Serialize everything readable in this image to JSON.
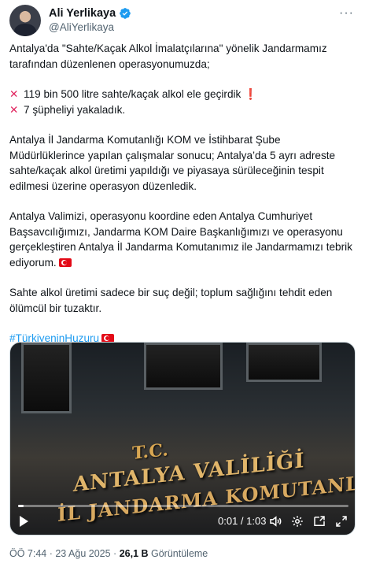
{
  "tweet": {
    "author_name": "Ali Yerlikaya",
    "author_handle": "@AliYerlikaya",
    "more_icon": "more-horizontal-icon",
    "paragraphs": {
      "intro_1": "Antalya'da \"Sahte/Kaçak Alkol İmalatçılarına\" yönelik Jandarmamız",
      "intro_2": "tarafından düzenlenen operasyonumuzda;",
      "bullet_1": "119 bin 500 litre sahte/kaçak alkol ele geçirdik",
      "bullet_1_mark": "❗",
      "bullet_2": "7 şüpheliyi yakaladık.",
      "bullet_icon": "✕",
      "p2_1": "Antalya İl Jandarma Komutanlığı KOM ve İstihbarat Şube",
      "p2_2": "Müdürlüklerince yapılan çalışmalar sonucu; Antalya’da 5 ayrı adreste",
      "p2_3": "sahte/kaçak alkol üretimi yapıldığı ve piyasaya sürüleceğinin tespit",
      "p2_4": "edilmesi üzerine operasyon düzenledik.",
      "p3_1": "Antalya Valimizi, operasyonu koordine eden Antalya Cumhuriyet",
      "p3_2": "Başsavcılığımızı, Jandarma KOM Daire Başkanlığımızı ve operasyonu",
      "p3_3": "gerçekleştiren Antalya İl Jandarma Komutanımız ile Jandarmamızı tebrik",
      "p3_4": "ediyorum.",
      "p4_1": "Sahte alkol üretimi sadece bir suç değil; toplum sağlığını tehdit eden",
      "p4_2": "ölümcül bir tuzaktır.",
      "hashtag": "#TürkiyeninHuzuru"
    },
    "video": {
      "sign_tc": "T.C.",
      "sign_line1": "ANTALYA VALİLİĞİ",
      "sign_line2": "İL JANDARMA KOMUTANLIĞI",
      "time": "0:01 / 1:03",
      "progress": 0.016,
      "icons": [
        "play-icon",
        "volume-icon",
        "settings-icon",
        "picture-in-picture-icon",
        "fullscreen-icon"
      ]
    },
    "footer": {
      "time": "ÖÖ 7:44 · 23 Ağu 2025 · ",
      "views_count": "26,1 B",
      "views_label": " Görüntüleme"
    },
    "colors": {
      "text": "#0f1419",
      "secondary": "#536471",
      "link": "#1d9bf0",
      "verified": "#1d9bf0",
      "alert": "#e0245e",
      "flag": "#e30a17"
    }
  }
}
